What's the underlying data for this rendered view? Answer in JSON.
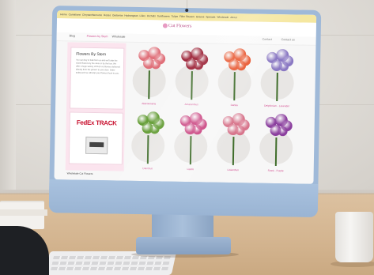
{
  "site": {
    "logo_text": "Cut Flowers",
    "topbar": [
      "Home",
      "Carnations",
      "Chrysanthemums",
      "Roses",
      "Gerberas",
      "Hydrangeas",
      "Lilies",
      "Orchids",
      "Sunflowers",
      "Tulips",
      "Filler Flowers",
      "Greens",
      "Specials",
      "Wholesale",
      "About"
    ],
    "nav": {
      "items": [
        "Blog",
        "Flowers by Stem",
        "Wholesale"
      ],
      "right_items": [
        "Contact",
        "Contact us"
      ]
    },
    "sidebar": {
      "title": "Flowers By Stem",
      "text": "You can buy in bulk from us and we'll ship the mixed flowers by the stem or by the box. We offer a huge variety of fresh cut flowers delivered directly from the grower to your door. Order today and we will ship your flowers fresh to you.",
      "tracking_brand": "FedEx TRACK",
      "note": "Wholesale Cut Flowers"
    },
    "products": [
      {
        "name": "Alstroemeria",
        "color": "#e0707a"
      },
      {
        "name": "Amaranthus",
        "color": "#9b2035"
      },
      {
        "name": "Dahlia",
        "color": "#e8532b"
      },
      {
        "name": "Delphinium - Lavender",
        "color": "#8a78c3"
      },
      {
        "name": "Dianthus",
        "color": "#5f9a2f"
      },
      {
        "name": "Liatris",
        "color": "#c9407e"
      },
      {
        "name": "Lisianthus",
        "color": "#d8758c"
      },
      {
        "name": "Stock - Purple",
        "color": "#8b3f9e"
      }
    ]
  }
}
